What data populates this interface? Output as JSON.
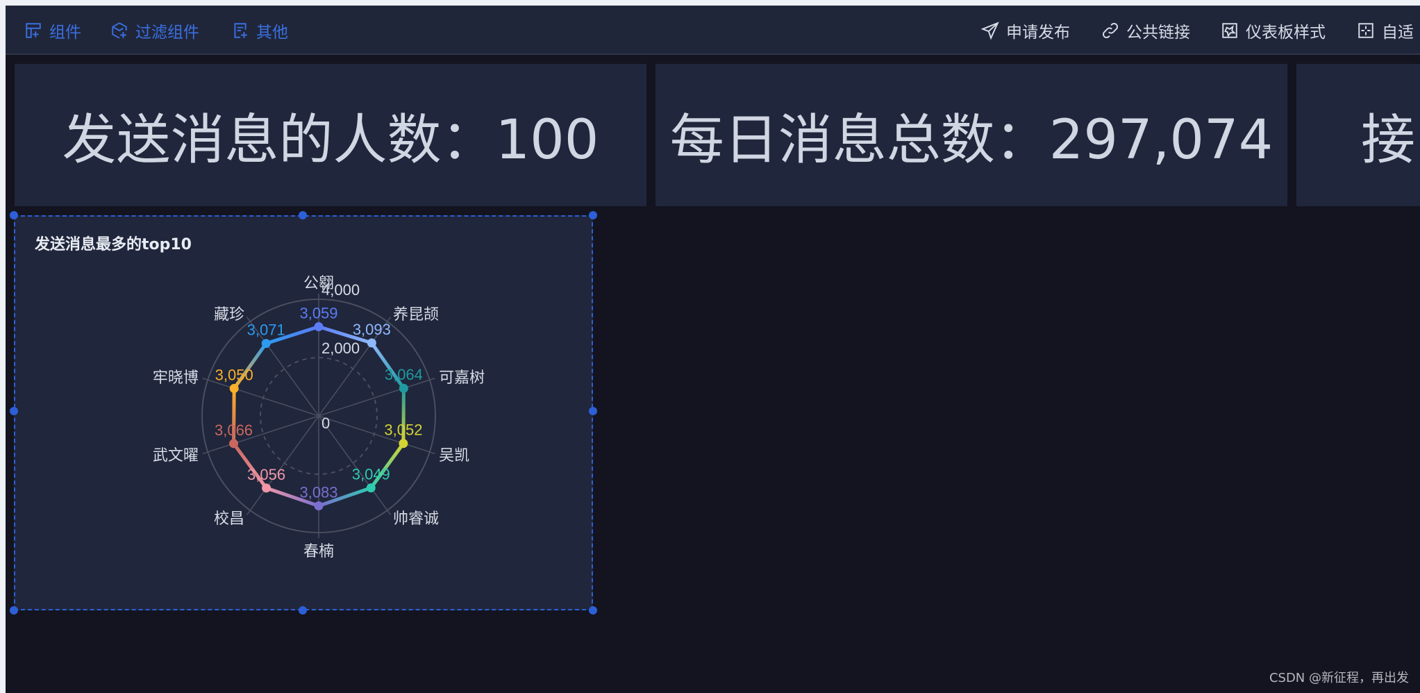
{
  "toolbar": {
    "left": [
      {
        "label": "组件",
        "icon": "add-component-icon"
      },
      {
        "label": "过滤组件",
        "icon": "filter-component-icon"
      },
      {
        "label": "其他",
        "icon": "other-icon"
      }
    ],
    "right": [
      {
        "label": "申请发布",
        "icon": "send-icon"
      },
      {
        "label": "公共链接",
        "icon": "link-icon"
      },
      {
        "label": "仪表板样式",
        "icon": "style-icon"
      },
      {
        "label": "自适",
        "icon": "grid-icon"
      }
    ]
  },
  "cards": [
    {
      "text": "发送消息的人数：100"
    },
    {
      "text": "每日消息总数：297,074"
    },
    {
      "text": "接"
    }
  ],
  "panel": {
    "title": "发送消息最多的top10"
  },
  "watermark": "CSDN @新征程，再出发",
  "chart_data": {
    "type": "radar",
    "title": "发送消息最多的top10",
    "indicators": [
      "公翱",
      "养昆颉",
      "可嘉树",
      "吴凯",
      "帅睿诚",
      "春楠",
      "校昌",
      "武文曜",
      "牢晓博",
      "藏珍"
    ],
    "values": [
      3059,
      3093,
      3064,
      3052,
      3049,
      3083,
      3056,
      3066,
      3050,
      3071
    ],
    "value_labels": [
      "3,059",
      "3,093",
      "3,064",
      "3,052",
      "3,049",
      "3,083",
      "3,056",
      "3,066",
      "3,050",
      "3,071"
    ],
    "point_colors": [
      "#5b7cf5",
      "#8fb9ff",
      "#1e9aa0",
      "#d4d434",
      "#2ecbb0",
      "#7b6fd0",
      "#ef97a8",
      "#c9675f",
      "#fbb02a",
      "#2d9af0"
    ],
    "radial_ticks": [
      "0",
      "2,000",
      "4,000"
    ],
    "radial_tick_values": [
      0,
      2000,
      4000
    ],
    "max": 4000,
    "shape": "circle"
  },
  "colors": {
    "accent": "#2d5fd8",
    "background": "#13141f",
    "card": "#20263b"
  }
}
